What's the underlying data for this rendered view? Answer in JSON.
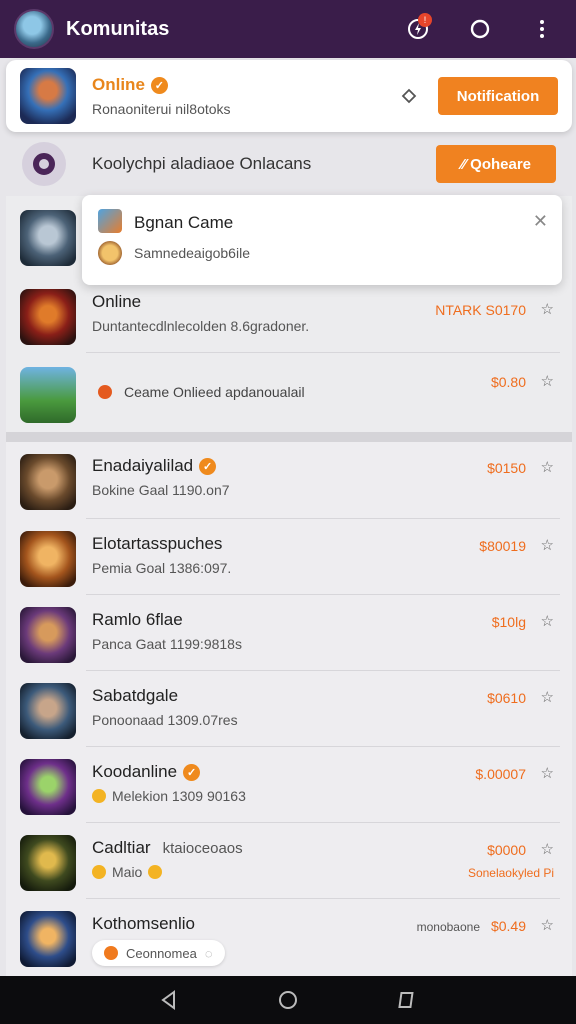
{
  "appbar": {
    "title": "Komunitas",
    "notification_badge": "!",
    "icons": [
      "avatar",
      "bolt-icon",
      "chat-icon",
      "more-vert-icon"
    ]
  },
  "online_card": {
    "title": "Online",
    "subtitle": "Ronaoniterui nil8otoks",
    "button": "Notification"
  },
  "community": {
    "label": "Koolychpi aladiaoe Onlacans",
    "button": "⁄⁄ Qoheare"
  },
  "popup": {
    "title": "Bgnan Came",
    "subtitle": "Samnedeaigob6ile"
  },
  "section_a": [
    {
      "title": "Online",
      "subtitle": "Duntantecdlnlecolden 8.6gradoner.",
      "price": "NTARK S0170"
    },
    {
      "title": "",
      "subtitle": "Ceame Onlieed apdanoualail",
      "price": "$0.80"
    }
  ],
  "list": [
    {
      "title": "Enadaiyalilad",
      "verified": true,
      "subtitle": "Bokine Gaal 1190.on7",
      "price": "$0150"
    },
    {
      "title": "Elotartasspuches",
      "verified": false,
      "subtitle": "Pemia Goal 1386:097.",
      "price": "$80019"
    },
    {
      "title": "Ramlo 6flae",
      "verified": false,
      "subtitle": "Panca Gaat 1199:9818s",
      "price": "$10lg"
    },
    {
      "title": "Sabatdgale",
      "verified": false,
      "subtitle": "Ponoonaad 1309.07res",
      "price": "$0610"
    },
    {
      "title": "Koodanline",
      "verified": true,
      "subtitle": "Melekion 1309 90163",
      "price": "$.00007"
    },
    {
      "title": "Cadltiar",
      "title_extra": "ktaioceoaos",
      "verified": false,
      "subtitle": "Maio",
      "price": "$0000",
      "price_sub": "Sonelaokyled Pi"
    },
    {
      "title": "Kothomsenlio",
      "verified": false,
      "subtitle": "Ceonnomea",
      "price": "$0.49",
      "price_prefix": "monobaone"
    }
  ],
  "colors": {
    "appbar": "#3a1d4a",
    "accent": "#f08220",
    "price": "#ef6d1e"
  }
}
